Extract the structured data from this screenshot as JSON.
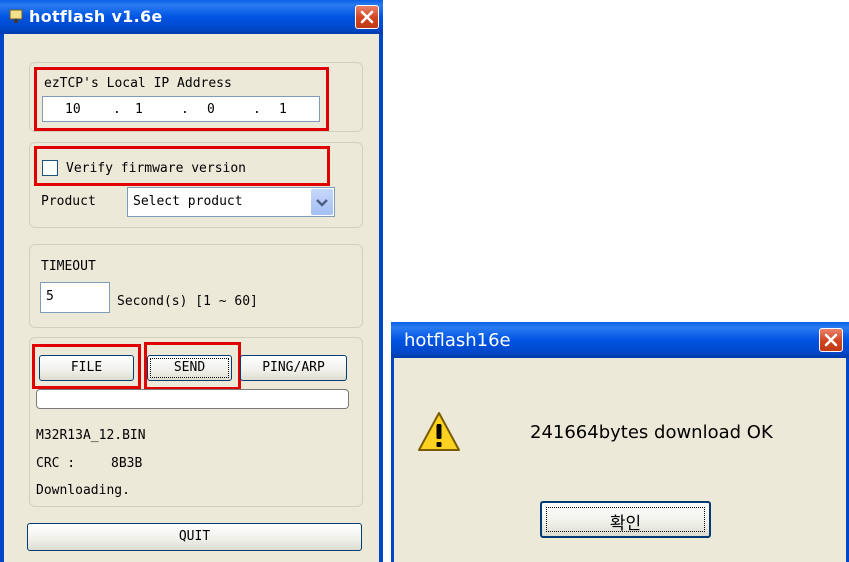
{
  "main_window": {
    "title": "hotflash v1.6e",
    "ip_group": {
      "label": "ezTCP's Local IP Address",
      "octets": [
        "10",
        "1",
        "0",
        "1"
      ],
      "separator": "."
    },
    "verify": {
      "label": "Verify firmware version",
      "checked": false
    },
    "product": {
      "label": "Product",
      "selected": "Select product"
    },
    "timeout": {
      "label": "TIMEOUT",
      "value": "5",
      "unit_text": "Second(s) [1 ~ 60]"
    },
    "buttons": {
      "file": "FILE",
      "send": "SEND",
      "ping": "PING/ARP",
      "quit": "QUIT"
    },
    "progress_fraction": 0,
    "status": {
      "filename": "M32R13A_12.BIN",
      "crc_label": "CRC :",
      "crc_value": "8B3B",
      "state": "Downloading."
    }
  },
  "dialog": {
    "title": "hotflash16e",
    "message": "241664bytes download OK",
    "ok_button": "확인",
    "icon": "warning-icon"
  },
  "colors": {
    "titlebar": "#0054e3",
    "window_bg": "#ece9d8",
    "highlight_red": "#e00000",
    "close_button": "#d2431f"
  }
}
